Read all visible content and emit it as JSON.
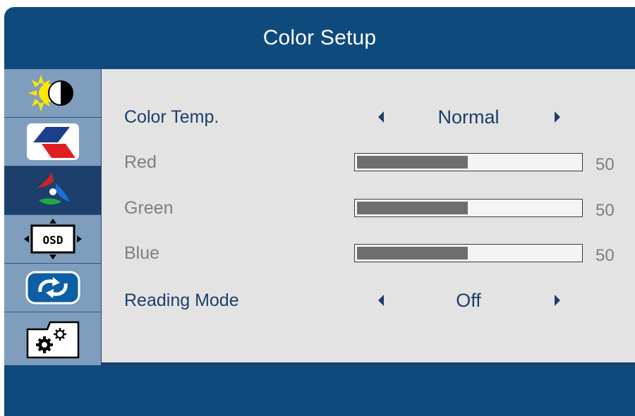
{
  "title": "Color Setup",
  "sidebar": {
    "items": [
      {
        "icon": "brightness-contrast-icon",
        "active": false
      },
      {
        "icon": "image-setup-icon",
        "active": false
      },
      {
        "icon": "color-setup-icon",
        "active": true
      },
      {
        "icon": "osd-setup-icon",
        "active": false
      },
      {
        "icon": "reset-icon",
        "active": false
      },
      {
        "icon": "extra-settings-icon",
        "active": false
      }
    ]
  },
  "osd_icon_text": "OSD",
  "rows": {
    "color_temp": {
      "label": "Color Temp.",
      "value": "Normal"
    },
    "red": {
      "label": "Red",
      "value": "50",
      "level": 0.5
    },
    "green": {
      "label": "Green",
      "value": "50",
      "level": 0.5
    },
    "blue": {
      "label": "Blue",
      "value": "50",
      "level": 0.5
    },
    "reading_mode": {
      "label": "Reading Mode",
      "value": "Off"
    }
  },
  "colors": {
    "frame": "#0f4a7d",
    "panel": "#e3e3e3",
    "active_item": "#1c3f6b",
    "inactive_item": "#7f9dbd",
    "enabled_text": "#1d3e6c",
    "disabled_text": "#7f7f7f",
    "bar_fill": "#6e6e6e"
  }
}
